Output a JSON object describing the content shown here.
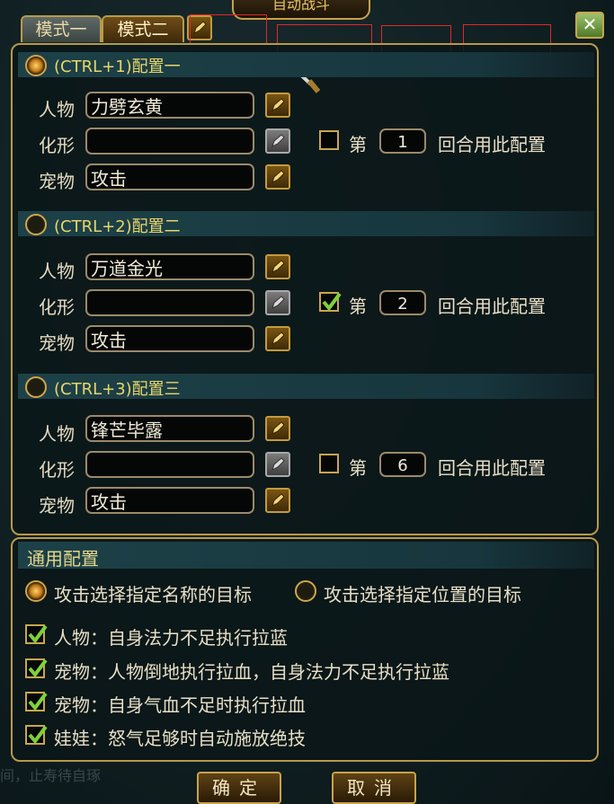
{
  "window": {
    "title": "自动战斗",
    "close_icon": "close-icon"
  },
  "tabs": [
    {
      "label": "模式一"
    },
    {
      "label": "模式二"
    }
  ],
  "configs": [
    {
      "title": "(CTRL+1)配置一",
      "selected": true,
      "person_label": "人物",
      "person_value": "力劈玄黄",
      "transform_label": "化形",
      "transform_value": "",
      "pet_label": "宠物",
      "pet_value": "攻击",
      "checked": false,
      "round_prefix": "第",
      "round": "1",
      "round_suffix": "回合用此配置"
    },
    {
      "title": "(CTRL+2)配置二",
      "selected": false,
      "person_label": "人物",
      "person_value": "万道金光",
      "transform_label": "化形",
      "transform_value": "",
      "pet_label": "宠物",
      "pet_value": "攻击",
      "checked": true,
      "round_prefix": "第",
      "round": "2",
      "round_suffix": "回合用此配置"
    },
    {
      "title": "(CTRL+3)配置三",
      "selected": false,
      "person_label": "人物",
      "person_value": "锋芒毕露",
      "transform_label": "化形",
      "transform_value": "",
      "pet_label": "宠物",
      "pet_value": "攻击",
      "checked": false,
      "round_prefix": "第",
      "round": "6",
      "round_suffix": "回合用此配置"
    }
  ],
  "general": {
    "title": "通用配置",
    "target_options": [
      {
        "label": "攻击选择指定名称的目标",
        "selected": true
      },
      {
        "label": "攻击选择指定位置的目标",
        "selected": false
      }
    ],
    "options": [
      {
        "label": "人物：自身法力不足执行拉蓝",
        "checked": true
      },
      {
        "label": "宠物：人物倒地执行拉血，自身法力不足执行拉蓝",
        "checked": true
      },
      {
        "label": "宠物：自身气血不足时执行拉血",
        "checked": true
      },
      {
        "label": "娃娃：怒气足够时自动施放绝技",
        "checked": true
      }
    ]
  },
  "buttons": {
    "confirm": "确定",
    "cancel": "取消"
  },
  "background_text": "间，止寿待自琢",
  "colors": {
    "accent_gold": "#c9a24a",
    "header_teal": "#1d4148",
    "title_yellow": "#e9d56a"
  }
}
